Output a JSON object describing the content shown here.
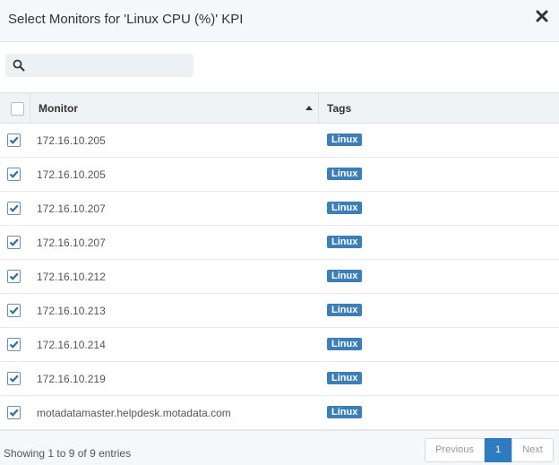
{
  "dialog": {
    "title": "Select Monitors for 'Linux CPU (%)' KPI"
  },
  "search": {
    "placeholder": "",
    "value": ""
  },
  "table": {
    "columns": {
      "monitor": "Monitor",
      "tags": "Tags"
    },
    "select_all_checked": false,
    "rows": [
      {
        "monitor": "172.16.10.205",
        "tag": "Linux",
        "checked": true
      },
      {
        "monitor": "172.16.10.205",
        "tag": "Linux",
        "checked": true
      },
      {
        "monitor": "172.16.10.207",
        "tag": "Linux",
        "checked": true
      },
      {
        "monitor": "172.16.10.207",
        "tag": "Linux",
        "checked": true
      },
      {
        "monitor": "172.16.10.212",
        "tag": "Linux",
        "checked": true
      },
      {
        "monitor": "172.16.10.213",
        "tag": "Linux",
        "checked": true
      },
      {
        "monitor": "172.16.10.214",
        "tag": "Linux",
        "checked": true
      },
      {
        "monitor": "172.16.10.219",
        "tag": "Linux",
        "checked": true
      },
      {
        "monitor": "motadatamaster.helpdesk.motadata.com",
        "tag": "Linux",
        "checked": true
      }
    ]
  },
  "footer": {
    "info": "Showing 1 to 9 of 9 entries",
    "pagination": {
      "previous": "Previous",
      "current": "1",
      "next": "Next"
    }
  },
  "colors": {
    "tag_bg": "#3c7fb8",
    "active_page": "#2f7bbf",
    "header_bg": "#f5f7fa"
  },
  "icons": {
    "close": "close-icon",
    "search": "search-icon",
    "sort": "sort-ascending-icon",
    "check": "check-icon"
  }
}
